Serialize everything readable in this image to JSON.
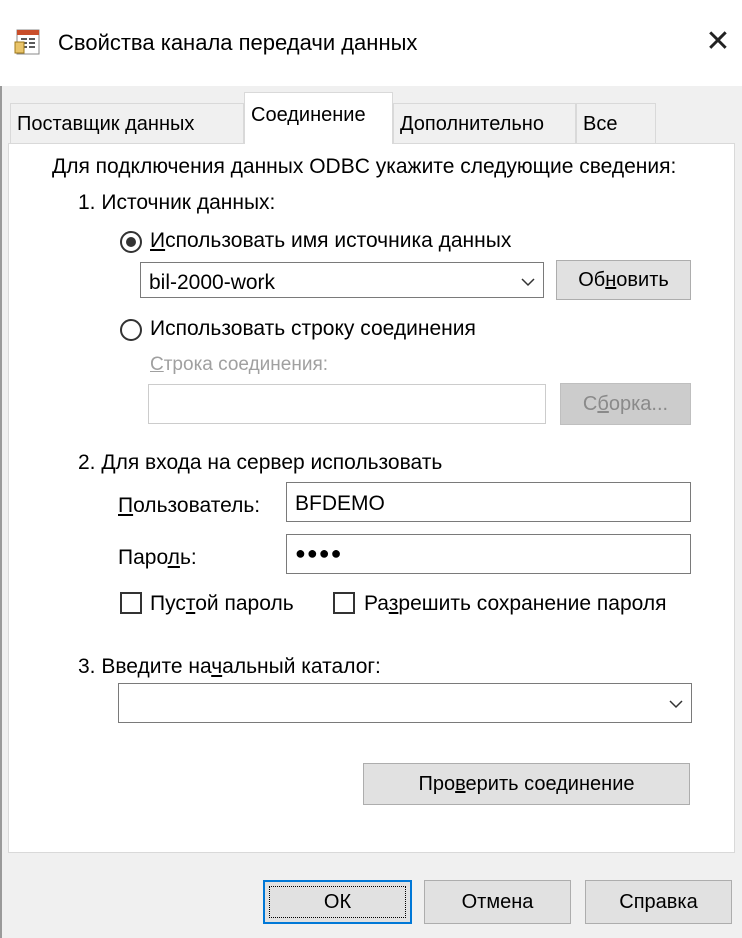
{
  "window": {
    "title": "Свойства канала передачи данных",
    "close_glyph": "✕"
  },
  "tabs": [
    {
      "label": "Поставщик данных",
      "active": false
    },
    {
      "label": "Соединение",
      "active": true
    },
    {
      "label": "Дополнительно",
      "active": false
    },
    {
      "label": "Все",
      "active": false
    }
  ],
  "connection": {
    "intro": "Для подключения данных ODBC укажите следующие сведения:",
    "section1": {
      "heading": "1. Источник данных:",
      "use_dsn": {
        "label_u": "И",
        "label_rest": "спользовать имя источника данных",
        "selected": true
      },
      "dsn_value": "bil-2000-work",
      "refresh_button": {
        "pre": "Об",
        "u": "н",
        "post": "овить"
      },
      "use_connstring": {
        "pre": "Использовать строку сое",
        "u": "д",
        "post": "инения",
        "selected": false
      },
      "connstring_label": {
        "u": "С",
        "rest": "трока соединения:"
      },
      "connstring_value": "",
      "build_button": {
        "pre": "С",
        "u": "б",
        "post": "орка..."
      }
    },
    "section2": {
      "heading": "2. Для входа на сервер использовать",
      "user_label": {
        "u": "П",
        "rest": "ользователь:"
      },
      "user_value": "BFDEMO",
      "password_label": {
        "pre": "Паро",
        "u": "л",
        "post": "ь:"
      },
      "password_value": "●●●●",
      "blank_password": {
        "pre": "Пус",
        "u": "т",
        "post": "ой пароль",
        "checked": false
      },
      "allow_save": {
        "pre": "Ра",
        "u": "з",
        "post": "решить сохранение пароля",
        "checked": false
      }
    },
    "section3": {
      "heading_pre": "3. Введите на",
      "heading_u": "ч",
      "heading_post": "альный каталог:",
      "catalog_value": ""
    },
    "test_button": {
      "pre": "Про",
      "u": "в",
      "post": "ерить соединение"
    }
  },
  "footer": {
    "ok": "ОК",
    "cancel": "Отмена",
    "help": "Справка"
  },
  "colors": {
    "accent": "#0078d7",
    "disabled_text": "#a0a0a0"
  }
}
